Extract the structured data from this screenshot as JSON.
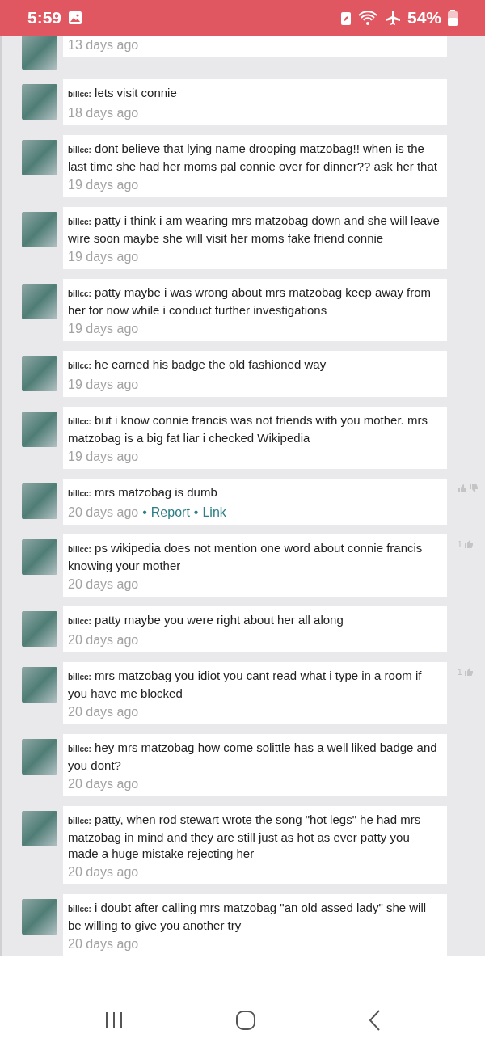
{
  "status_bar": {
    "time": "5:59",
    "battery": "54%"
  },
  "comments": [
    {
      "time": "13 days ago"
    },
    {
      "user": "billcc:",
      "text": "lets visit connie",
      "time": "18 days ago"
    },
    {
      "user": "billcc:",
      "text": "dont believe that lying name drooping matzobag!! when is the last time she had her moms pal connie over for dinner?? ask her that",
      "time": "19 days ago"
    },
    {
      "user": "billcc:",
      "text": "patty i think i am wearing mrs matzobag down and she will leave wire soon maybe she will visit her moms fake friend connie",
      "time": "19 days ago"
    },
    {
      "user": "billcc:",
      "text": "patty maybe i was wrong about mrs matzobag keep away from her for now while i conduct further investigations",
      "time": "19 days ago"
    },
    {
      "user": "billcc:",
      "text": "he earned his badge the old fashioned way",
      "time": "19 days ago"
    },
    {
      "user": "billcc:",
      "text": "but i know connie francis was not friends with you mother. mrs matzobag is a big fat liar i checked Wikipedia",
      "time": "19 days ago"
    },
    {
      "user": "billcc:",
      "text": "mrs matzobag is dumb",
      "time": "20 days ago",
      "actions": [
        {
          "sep": "•",
          "label": "Report"
        },
        {
          "sep": "•",
          "label": "Link"
        }
      ],
      "thumbs": true
    },
    {
      "user": "billcc:",
      "text": "ps wikipedia does not mention one word about connie francis knowing your mother",
      "time": "20 days ago",
      "votes": "1"
    },
    {
      "user": "billcc:",
      "text": "patty maybe you were right about her all along",
      "time": "20 days ago"
    },
    {
      "user": "billcc:",
      "text": "mrs matzobag you idiot you cant read what i type in a room if you have me blocked",
      "time": "20 days ago",
      "votes": "1"
    },
    {
      "user": "billcc:",
      "text": "hey mrs matzobag how come solittle has a well liked badge and you dont?",
      "time": "20 days ago"
    },
    {
      "user": "billcc:",
      "text": "patty, when rod stewart wrote the song \"hot legs\" he had mrs matzobag in mind and they are still just as hot as ever patty you made a huge mistake rejecting her",
      "time": "20 days ago"
    },
    {
      "user": "billcc:",
      "text": "i doubt after calling mrs matzobag \"an old assed lady\" she will be willing to give you another try",
      "time": "20 days ago"
    }
  ]
}
